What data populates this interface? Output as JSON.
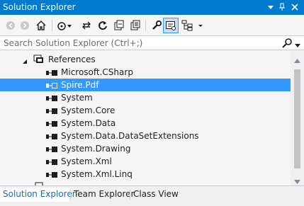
{
  "window": {
    "title": "Solution Explorer",
    "controls": [
      "dropdown-icon",
      "pin-icon",
      "close-icon"
    ]
  },
  "toolbar": {
    "icons": [
      "back-icon",
      "forward-icon",
      "home-icon",
      "pending-changes-icon",
      "sync-icon",
      "refresh-icon",
      "collapse-all-icon",
      "show-all-files-icon",
      "properties-icon",
      "preview-icon",
      "class-diagram-icon",
      "dropdown-icon"
    ]
  },
  "search": {
    "placeholder": "Search Solution Explorer (Ctrl+;)"
  },
  "tree": {
    "parent": {
      "label": "References",
      "expanded": true
    },
    "items": [
      {
        "label": "Microsoft.CSharp",
        "selected": false
      },
      {
        "label": "Spire.Pdf",
        "selected": true
      },
      {
        "label": "System",
        "selected": false
      },
      {
        "label": "System.Core",
        "selected": false
      },
      {
        "label": "System.Data",
        "selected": false
      },
      {
        "label": "System.Data.DataSetExtensions",
        "selected": false
      },
      {
        "label": "System.Drawing",
        "selected": false
      },
      {
        "label": "System.Xml",
        "selected": false
      },
      {
        "label": "System.Xml.Linq",
        "selected": false
      }
    ]
  },
  "tabs": [
    {
      "label": "Solution Explorer",
      "active": true
    },
    {
      "label": "Team Explorer",
      "active": false
    },
    {
      "label": "Class View",
      "active": false
    }
  ],
  "colors": {
    "accent": "#007acc",
    "selection": "#3399ff",
    "active_tab_text": "#0e70c0"
  }
}
